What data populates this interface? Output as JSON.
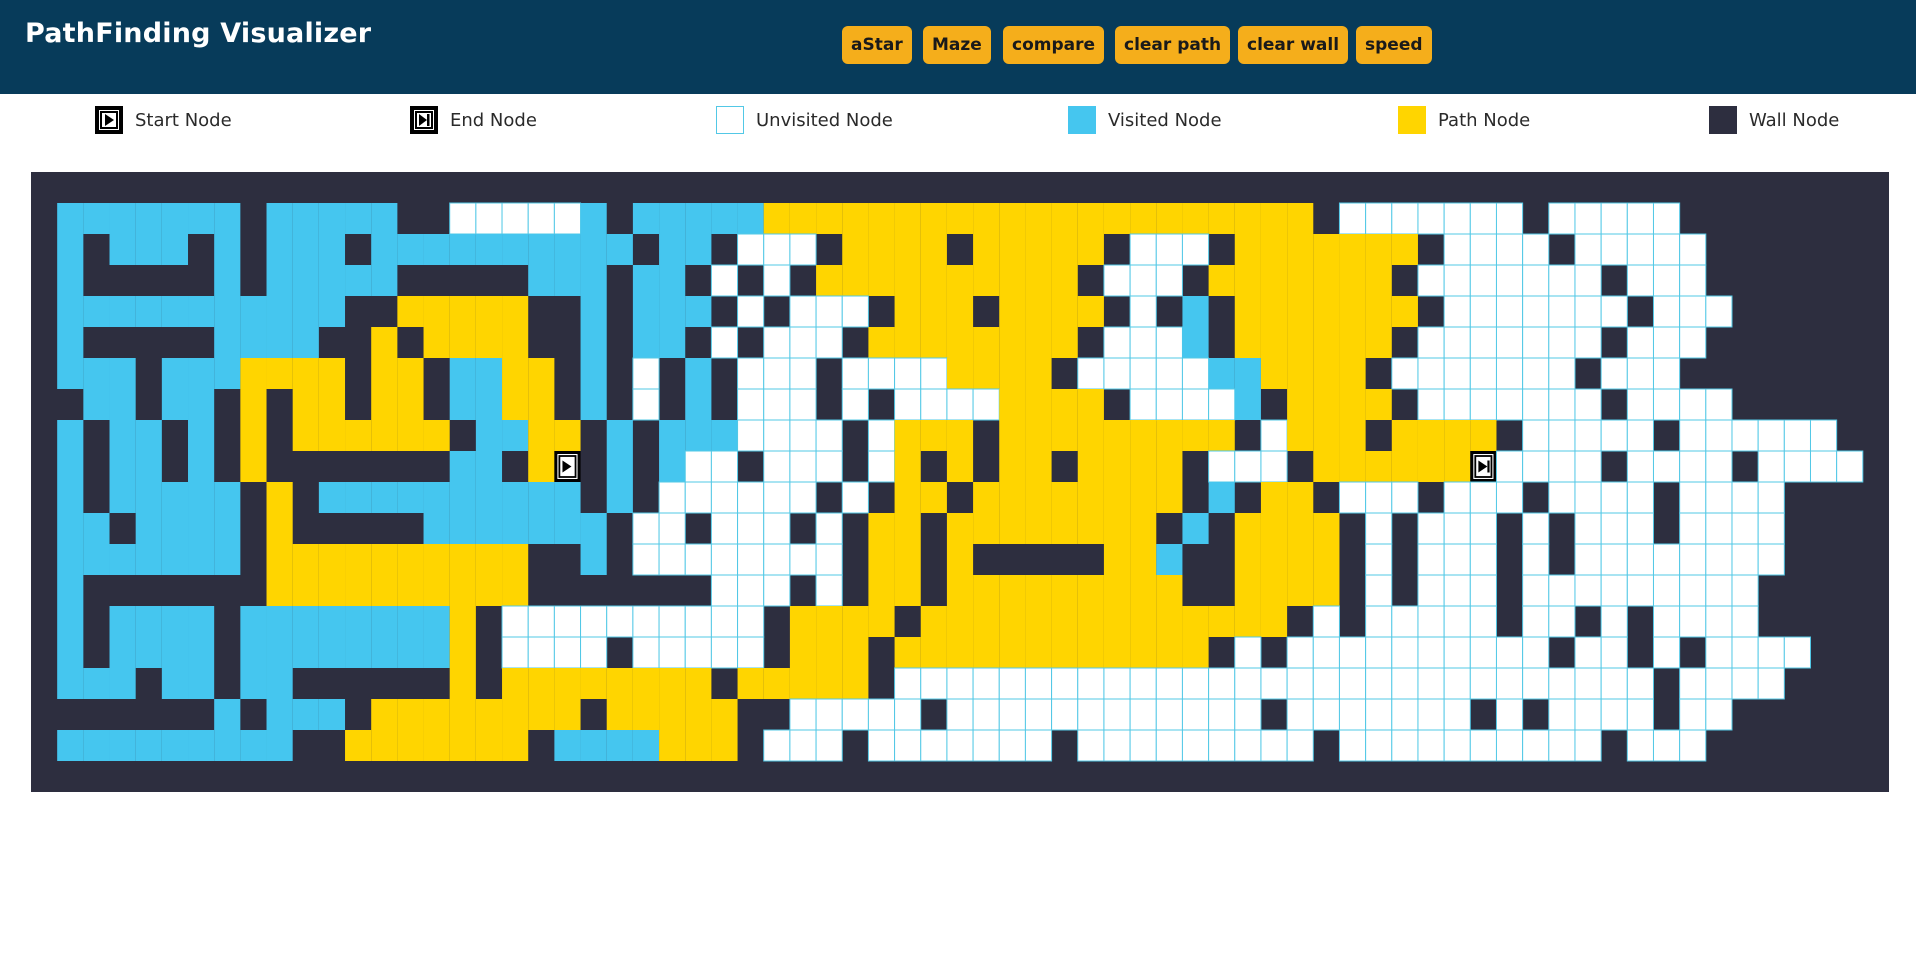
{
  "header": {
    "title": "PathFinding Visualizer",
    "buttons": [
      "aStar",
      "Maze",
      "compare",
      "clear path",
      "clear wall",
      "speed"
    ]
  },
  "legend": [
    "Start Node",
    "End Node",
    "Unvisited Node",
    "Visited Node",
    "Path Node",
    "Wall Node"
  ],
  "colors": {
    "header_bg": "#073b5a",
    "button": "#f5ae1b",
    "wall": "#2d2e3f",
    "visited": "#45c6ef",
    "path": "#ffd500",
    "unvisited": "#ffffff",
    "unvisited_border": "#52c8e6"
  },
  "icons": {
    "start": "play-in-square-icon",
    "end": "skip-forward-in-square-icon"
  },
  "grid": {
    "start": [
      9,
      15
    ],
    "end": [
      9,
      47
    ],
    "map": [
      "###############################################################",
      "#VVVVVVV#VVVVV##UUUUUV#VVVVVPPPPPPPPPPPPPPPPPPPPP#UUUUUUU#UUUUU#",
      "#V#VVV#V#VVV#VVVVVVVVVV#VV#UUU#PPPP#PPPPP#UUU#PPPPPPP#UUUU#UUUUU#",
      "#V#####V#VVVVV#####VVV#VV#U#U#PPPPPPPPPP#UUU#PPPPPPP#UUUUUUU#UUU#",
      "#VVVVVVVVVVV##PPPPP##V#VVV#U#UUU#PPP#PPPP#U#V#PPPPPPP#UUUUUUU#UUU#",
      "#V#####VVVV##P#PPPP##V#VV#U#UUU#PPPPPPPP#UUUV#PPPPPP#UUUUUUU#UUU#",
      "#VVV#VVVPPPP#PP#VVPP#V#U#V#UUU#UUUUPPPP#UUUUUVVPPPP#UUUUUUU#UUU#",
      "##VV#VV#P#PP#PP#VVPP#V#U#V#UUU#U#UUUUPPPP#UUUUV#PPPP#UUUUUUU#UUUU#",
      "#V#VV#V#P#PPPPPP#VVPP#V#VVVUUUU#UPPP#PPPPPPPPP#UPPP#PPPP#UUUUU#UUUUUU#",
      "#V#VV#V#P#######VV#PS#V#VUU#UUU#UP#P#PP#PPPP#UUU#PPPPPPEUUUU#UUUU#UUUU#",
      "#V#VVVVV#P#VVVVVVVVVV#V#UUUUUU#U#PP#PPPPPPPP#V#PP#UUU#UUU#UUUU#UUUU#",
      "#VV#VVVV#P#####VVVVVVV#UU#UUU#U#PP#PPPPPPPP#V#PPPP#U#UUU#U#UUU#UUUU#",
      "#VVVVVVV#PPPPPPPPPP##V#UUUUUUUU#PP#P#####PPV##PPPP#U#UUU#U#UUUUUUUU#",
      "#V#######PPPPPPPPPP#######UUU#U#PP#PPPPPPPPP##PPPP#U#UUU#UUUUUUUUU#",
      "#V#VVVV#VVVVVVVVP#UUUUUUUUUU#PPPP#PPPPPPPPPPPPPP#U#UUUUU#UU#U#UUUU#",
      "#V#VVVV#VVVVVVVVP#UUUU#UUUUU#PPP#PPPPPPPPPPPP#U#UUUUUUUUUU#UU#U#UUUU#",
      "#VVV#VV#VV######P#PPPPPPPP#PPPPP#UUUUUUUUUUUUUUUUUUUUUUUUUUUUU#UUUU#",
      "#######V#VVV#PPPPPPPP#PPPPP##UUUUU#UUUUUUUUUUUU#UUUUUUU#U#UUUU#UU#",
      "#VVVVVVVVV##PPPPPPP#VVVVPPP#UUU#UUUUUUU#UUUUUUUUU#UUUUUUUUUU#UUU#",
      "###############################################################"
    ]
  }
}
